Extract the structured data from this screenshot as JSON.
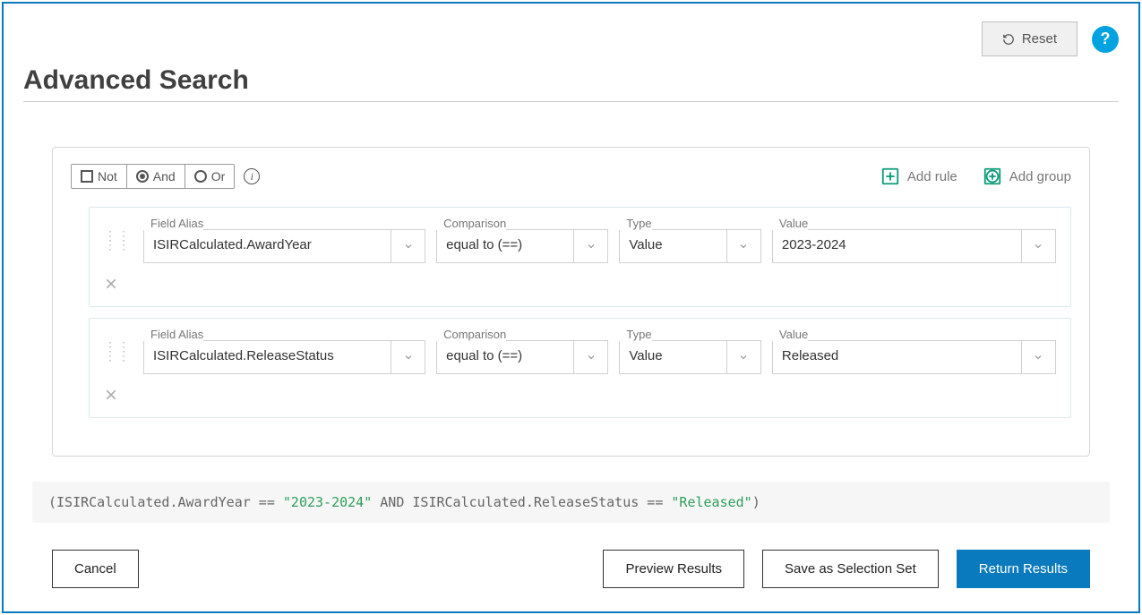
{
  "topbar": {
    "reset_label": "Reset",
    "help_label": "?"
  },
  "page_title": "Advanced Search",
  "logic": {
    "not_label": "Not",
    "and_label": "And",
    "or_label": "Or",
    "selected": "And"
  },
  "actions": {
    "add_rule_label": "Add rule",
    "add_group_label": "Add group"
  },
  "labels": {
    "field_alias": "Field Alias",
    "comparison": "Comparison",
    "type": "Type",
    "value": "Value"
  },
  "rules": [
    {
      "field_alias": "ISIRCalculated.AwardYear",
      "comparison": "equal to (==)",
      "type": "Value",
      "value": "2023-2024"
    },
    {
      "field_alias": "ISIRCalculated.ReleaseStatus",
      "comparison": "equal to (==)",
      "type": "Value",
      "value": "Released"
    }
  ],
  "query": {
    "open": "(",
    "f1": "ISIRCalculated.AwardYear",
    "op": " == ",
    "v1": "\"2023-2024\"",
    "and": " AND ",
    "f2": "ISIRCalculated.ReleaseStatus",
    "v2": "\"Released\"",
    "close": ")"
  },
  "footer": {
    "cancel": "Cancel",
    "preview": "Preview Results",
    "save": "Save as Selection Set",
    "return": "Return Results"
  }
}
